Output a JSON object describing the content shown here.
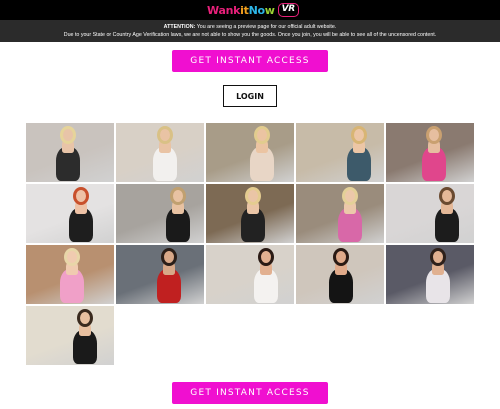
{
  "header": {
    "logo": {
      "part1": "Wank",
      "part2": "it",
      "part3": "No",
      "part4": "w",
      "badge": "VR"
    }
  },
  "notice": {
    "label": "ATTENTION:",
    "line1": "You are seeing a preview page for our official adult website.",
    "line2": "Due to your State or Country Age Verification laws, we are not able to show you the goods. Once you join, you will be able to see all of the uncensored content."
  },
  "cta_top": {
    "label": "GET INSTANT ACCESS"
  },
  "login": {
    "label": "LOGIN"
  },
  "cta_bottom": {
    "label": "GET INSTANT ACCESS"
  },
  "gallery": {
    "thumbnails": [
      {
        "bg": "#c9c3be",
        "accent": "#2c2c2c",
        "skin": "#e8c4a8",
        "hair": "#e6d49a"
      },
      {
        "bg": "#d8d0c6",
        "accent": "#f2f0ee",
        "skin": "#e9c3a4",
        "hair": "#d9c186"
      },
      {
        "bg": "#a89c88",
        "accent": "#e8d6c6",
        "skin": "#ebc4a2",
        "hair": "#e2cc8e"
      },
      {
        "bg": "#c7bba8",
        "accent": "#3d5a6a",
        "skin": "#ecc6a6",
        "hair": "#d8b574"
      },
      {
        "bg": "#8a7a70",
        "accent": "#e0468c",
        "skin": "#e6bea0",
        "hair": "#c9a070"
      },
      {
        "bg": "#e4e2e2",
        "accent": "#1e1e1e",
        "skin": "#eec2a6",
        "hair": "#c8502c"
      },
      {
        "bg": "#a7a39e",
        "accent": "#1a1a1a",
        "skin": "#e8c2a2",
        "hair": "#c0a070"
      },
      {
        "bg": "#7d6a54",
        "accent": "#222",
        "skin": "#eac5a6",
        "hair": "#e4cc90"
      },
      {
        "bg": "#9a8c7c",
        "accent": "#d868a8",
        "skin": "#ecc8aa",
        "hair": "#e4d098"
      },
      {
        "bg": "#d9d6d6",
        "accent": "#1c1c1c",
        "skin": "#e4b898",
        "hair": "#6a4a30"
      },
      {
        "bg": "#b89070",
        "accent": "#f0a0c8",
        "skin": "#f0cbb0",
        "hair": "#e8d6a8"
      },
      {
        "bg": "#6a7078",
        "accent": "#c02020",
        "skin": "#d8a888",
        "hair": "#2a1e18"
      },
      {
        "bg": "#d8d2ca",
        "accent": "#f4f2f0",
        "skin": "#e2b090",
        "hair": "#2a1a14"
      },
      {
        "bg": "#cfc6bc",
        "accent": "#141414",
        "skin": "#e0aa8a",
        "hair": "#2a1a14"
      },
      {
        "bg": "#5a5a66",
        "accent": "#e8e4e8",
        "skin": "#e0b090",
        "hair": "#2e201a"
      },
      {
        "bg": "#e2dccf",
        "accent": "#1a1a1a",
        "skin": "#e8c0a0",
        "hair": "#3a2a1e"
      }
    ]
  }
}
